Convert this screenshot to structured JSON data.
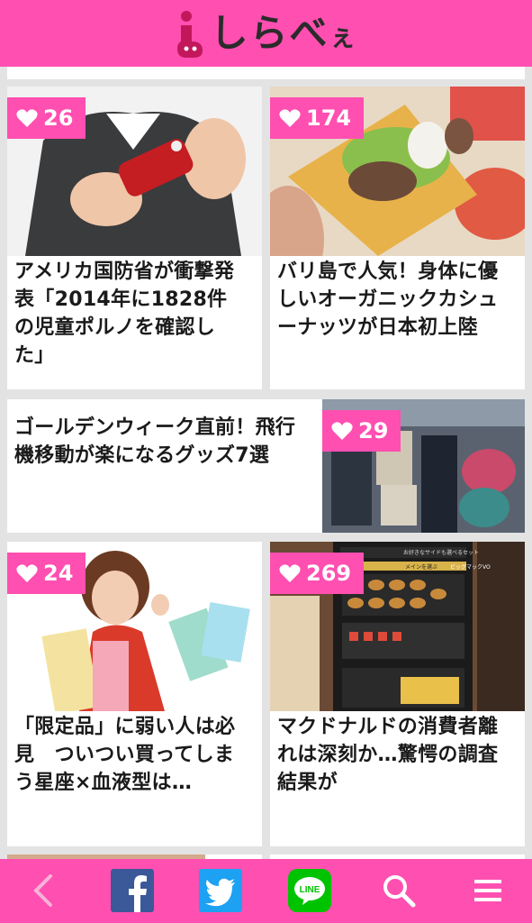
{
  "header": {
    "logo_main": "しらべ",
    "logo_small": "ぇ"
  },
  "articles": [
    {
      "likes": "26",
      "title": "アメリカ国防省が衝撃発\n表「2014年に1828件\nの児童ポルノを確認し\nた」"
    },
    {
      "likes": "174",
      "title": "バリ島で人気！身体に優\nしいオーガニックカシュ\nーナッツが日本初上陸"
    },
    {
      "likes": "29",
      "title": "ゴールデンウィーク直前！飛行\n機移動が楽になるグッズ7選"
    },
    {
      "likes": "24",
      "title": "「限定品」に弱い人は必\n見　ついつい買ってしま\nう星座×血液型は…"
    },
    {
      "likes": "269",
      "title": "マクドナルドの消費者離\nれは深刻か…驚愕の調査\n結果が"
    }
  ],
  "thumb_text": {
    "menu_header": "お好きなサイドも選べるセット",
    "menu_section": "メインを選ぶ",
    "menu_badge": "ビッグマックVO"
  },
  "bottom_bar": {
    "icons": [
      "back-icon",
      "facebook-icon",
      "twitter-icon",
      "line-icon",
      "search-icon",
      "menu-icon"
    ],
    "line_label": "LINE"
  },
  "colors": {
    "brand_pink": "#ff4fb1",
    "facebook": "#3b5998",
    "twitter": "#1da1f2",
    "line": "#00c300"
  }
}
